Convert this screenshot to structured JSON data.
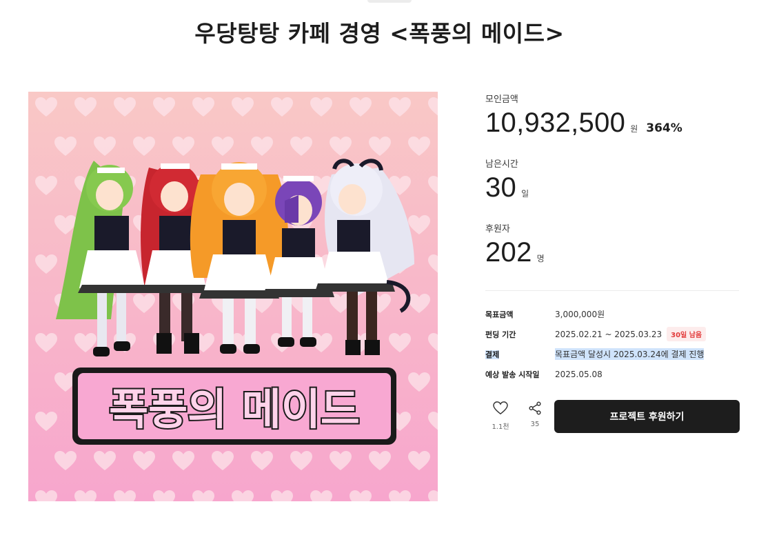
{
  "project": {
    "title": "우당탕탕 카페 경영 <폭풍의 메이드>"
  },
  "artwork": {
    "logo_text": "폭풍의 메이드",
    "colors": {
      "bg_top": "#f9c8c6",
      "bg_bottom": "#f7a6cd",
      "heart": "#fde4ea"
    }
  },
  "stats": {
    "raised_label": "모인금액",
    "raised_value": "10,932,500",
    "raised_unit": "원",
    "raised_percent": "364%",
    "time_label": "남은시간",
    "time_value": "30",
    "time_unit": "일",
    "backers_label": "후원자",
    "backers_value": "202",
    "backers_unit": "명"
  },
  "info": {
    "goal_key": "목표금액",
    "goal_value": "3,000,000원",
    "period_key": "펀딩 기간",
    "period_value": "2025.02.21 ~ 2025.03.23",
    "period_badge": "30일 남음",
    "payment_key": "결제",
    "payment_value": "목표금액 달성시 2025.03.24에 결제 진행",
    "ship_key": "예상 발송 시작일",
    "ship_value": "2025.05.08"
  },
  "actions": {
    "like_icon": "heart-icon",
    "like_count": "1.1천",
    "share_icon": "share-icon",
    "share_count": "35",
    "back_label": "프로젝트 후원하기"
  },
  "colors": {
    "primary": "#1d1d1d",
    "badge_bg": "#fdecec",
    "badge_text": "#e23b3b",
    "highlight": "#cfe3fb"
  }
}
